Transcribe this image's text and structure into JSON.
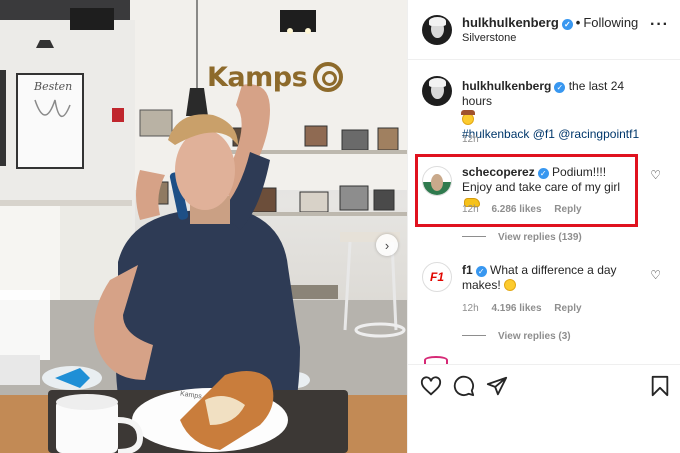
{
  "photo": {
    "brand_text": "Kamps",
    "sign_text": "Besten",
    "tray_text": "Kamps"
  },
  "header": {
    "username": "hulkhulkenberg",
    "separator": "•",
    "follow_label": "Following",
    "location": "Silverstone",
    "more_icon": "more-horizontal-icon"
  },
  "caption": {
    "username": "hulkhulkenberg",
    "text": "the last 24 hours",
    "emoji": "cowboy-face",
    "hashtags": "#hulkenback @f1 @racingpointf1",
    "time": "12h"
  },
  "comments": [
    {
      "username": "schecoperez",
      "text": "Podium!!!! Enjoy and take care of my girl",
      "emoji": "flexed-arm",
      "time": "12h",
      "likes": "6.286 likes",
      "reply_label": "Reply",
      "view_replies": "View replies (139)",
      "highlighted": true
    },
    {
      "username": "f1",
      "text": "What a difference a day makes!",
      "emoji": "smiling-face",
      "time": "12h",
      "likes": "4.196 likes",
      "reply_label": "Reply",
      "view_replies": "View replies (3)",
      "avatar_text": "F1"
    }
  ],
  "actions": {
    "like_icon": "heart-icon",
    "comment_icon": "comment-icon",
    "share_icon": "send-icon",
    "save_icon": "bookmark-icon"
  },
  "colors": {
    "highlight_border": "#e0121f",
    "verified": "#3897f0",
    "link": "#00376b",
    "muted": "#8e8e8e"
  }
}
